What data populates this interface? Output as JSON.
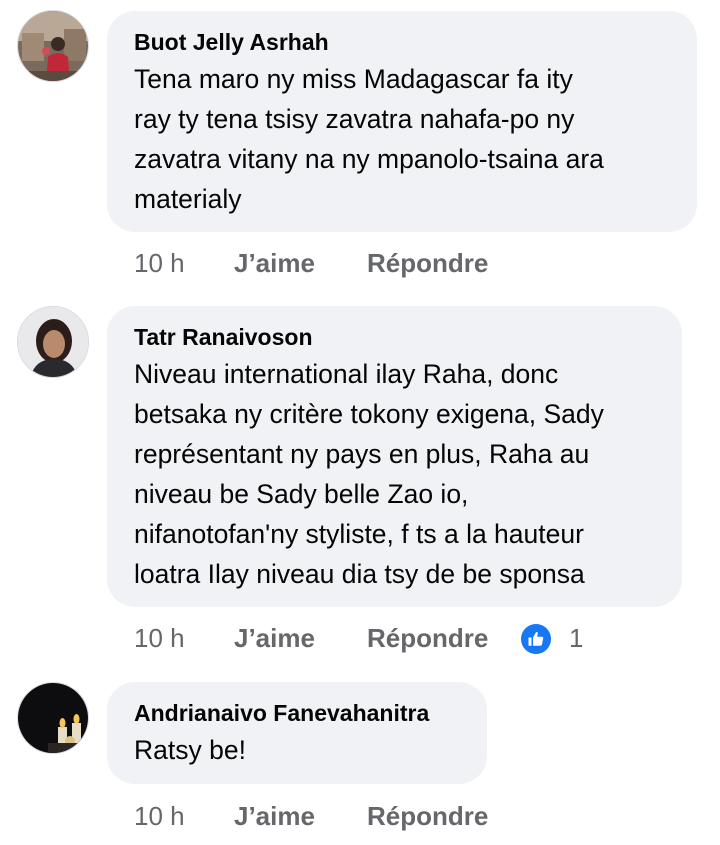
{
  "comments": [
    {
      "author": "Buot Jelly Asrhah",
      "text": "Tena maro ny miss Madagascar fa ity\nray ty tena tsisy zavatra nahafa-po ny\nzavatra vitany na ny mpanolo-tsaina ara\nmaterialy",
      "time": "10 h",
      "like_label": "J’aime",
      "reply_label": "Répondre"
    },
    {
      "author": "Tatr Ranaivoson",
      "text": "Niveau international ilay Raha, donc\nbetsaka ny critère tokony exigena, Sady\nreprésentant ny pays en plus, Raha au\nniveau be Sady belle Zao io,\nnifanotofan'ny styliste, f ts a la hauteur\nloatra Ilay niveau dia tsy de be sponsa",
      "time": "10 h",
      "like_label": "J’aime",
      "reply_label": "Répondre",
      "reaction_icon": "thumbs-up-icon",
      "reaction_count": "1"
    },
    {
      "author": "Andrianaivo Fanevahanitra",
      "text": "Ratsy be!",
      "time": "10 h",
      "like_label": "J’aime",
      "reply_label": "Répondre"
    }
  ],
  "colors": {
    "bubble": "#f0f2f5",
    "secondary_text": "#65676b",
    "reaction_blue": "#1877f2"
  }
}
